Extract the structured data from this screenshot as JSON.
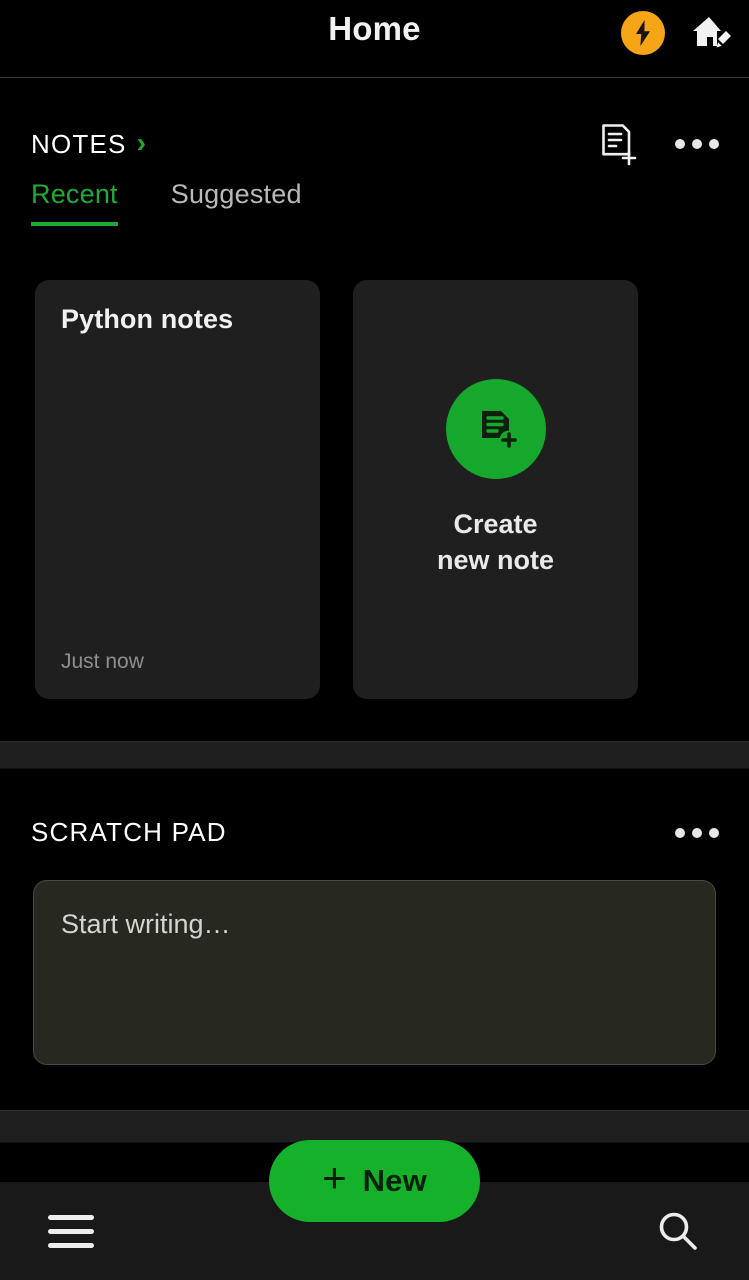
{
  "appbar": {
    "title": "Home",
    "bolt_icon": "lightning-bolt-icon",
    "bolt_color": "#f5a516",
    "home_edit_icon": "home-edit-icon"
  },
  "notes": {
    "section_label": "NOTES",
    "chevron": "›",
    "new_note_icon": "note-add-icon",
    "overflow_icon": "more-options-icon",
    "tabs": [
      {
        "label": "Recent",
        "active": true
      },
      {
        "label": "Suggested",
        "active": false
      }
    ],
    "cards": [
      {
        "kind": "note",
        "title": "Python notes",
        "timestamp": "Just now"
      },
      {
        "kind": "create",
        "icon": "create-note-icon",
        "label_line1": "Create",
        "label_line2": "new note"
      }
    ]
  },
  "scratch_pad": {
    "section_label": "SCRATCH PAD",
    "overflow_icon": "more-options-icon",
    "placeholder": "Start writing…",
    "value": ""
  },
  "bottom_nav": {
    "menu_icon": "hamburger-menu-icon",
    "search_icon": "search-icon"
  },
  "fab": {
    "plus": "+",
    "label": "New"
  },
  "colors": {
    "accent_green": "#16a82c",
    "fab_green": "#16b12b",
    "bolt_orange": "#f5a516",
    "card_bg": "#1f1f1f",
    "scratch_bg": "#272820",
    "page_bg": "#000000"
  }
}
